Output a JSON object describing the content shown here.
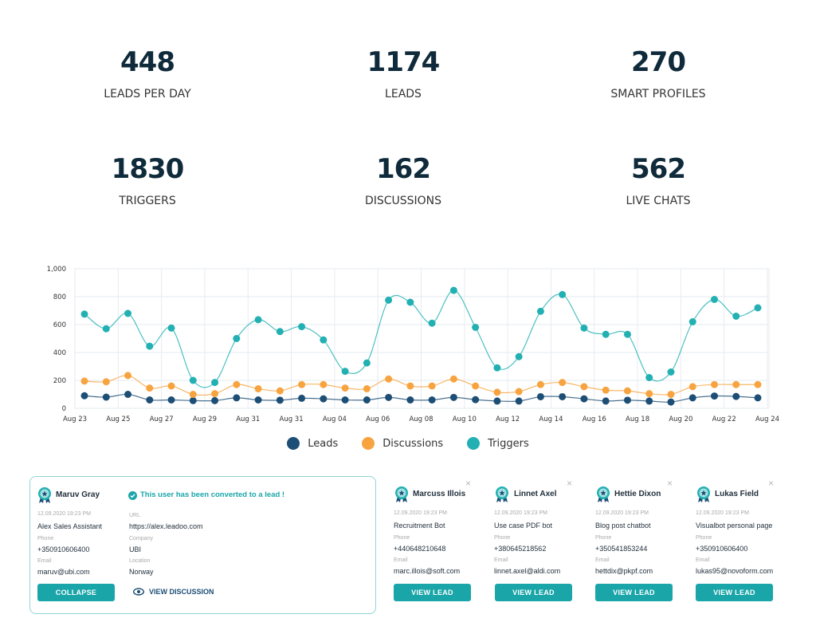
{
  "stats": [
    {
      "value": "448",
      "label": "LEADS PER DAY"
    },
    {
      "value": "1174",
      "label": "LEADS"
    },
    {
      "value": "270",
      "label": "SMART PROFILES"
    },
    {
      "value": "1830",
      "label": "TRIGGERS"
    },
    {
      "value": "162",
      "label": "DISCUSSIONS"
    },
    {
      "value": "562",
      "label": "LIVE CHATS"
    }
  ],
  "chart_data": {
    "type": "line",
    "title": "",
    "xlabel": "",
    "ylabel": "",
    "ylim": [
      0,
      1000
    ],
    "yticks": [
      "0",
      "200",
      "400",
      "600",
      "800",
      "1,000"
    ],
    "grid": true,
    "legend_position": "bottom",
    "x_tick_labels": [
      "Aug 23",
      "Aug 25",
      "Aug 27",
      "Aug 29",
      "Aug 31",
      "Aug 31",
      "Aug 04",
      "Aug 06",
      "Aug 08",
      "Aug 10",
      "Aug 12",
      "Aug 14",
      "Aug 16",
      "Aug 18",
      "Aug 20",
      "Aug 22",
      "Aug 24"
    ],
    "series": [
      {
        "name": "Leads",
        "color": "#1d4e75",
        "values": [
          90,
          80,
          100,
          60,
          60,
          55,
          55,
          75,
          60,
          58,
          72,
          68,
          60,
          60,
          78,
          60,
          60,
          78,
          62,
          52,
          52,
          83,
          83,
          68,
          52,
          58,
          52,
          45,
          75,
          88,
          85,
          75
        ]
      },
      {
        "name": "Discussions",
        "color": "#f7a440",
        "values": [
          195,
          190,
          235,
          145,
          160,
          100,
          105,
          170,
          140,
          125,
          170,
          170,
          145,
          140,
          210,
          160,
          160,
          210,
          160,
          115,
          120,
          170,
          185,
          155,
          130,
          125,
          105,
          100,
          155,
          170,
          170,
          170
        ]
      },
      {
        "name": "Triggers",
        "color": "#22b0b3",
        "values": [
          675,
          570,
          680,
          445,
          575,
          200,
          185,
          500,
          635,
          550,
          585,
          490,
          265,
          325,
          775,
          760,
          610,
          845,
          580,
          290,
          370,
          695,
          815,
          575,
          530,
          530,
          220,
          260,
          620,
          780,
          660,
          720
        ]
      }
    ]
  },
  "legend": [
    {
      "label": "Leads",
      "color": "#1d4e75"
    },
    {
      "label": "Discussions",
      "color": "#f7a440"
    },
    {
      "label": "Triggers",
      "color": "#22b0b3"
    }
  ],
  "expanded_card": {
    "name": "Maruv Gray",
    "converted_message": "This user has been converted to a lead !",
    "timestamp": "12.09.2020 19:23 PM",
    "bot": "Alex Sales Assistant",
    "phone_label": "Phone",
    "phone": "+350910606400",
    "email_label": "Email",
    "email": "maruv@ubi.com",
    "url_label": "URL",
    "url": "https://alex.leadoo.com",
    "company_label": "Company",
    "company": "UBI",
    "location_label": "Location",
    "location": "Norway",
    "collapse_label": "COLLAPSE",
    "view_discussion_label": "VIEW DISCUSSION"
  },
  "cards": [
    {
      "name": "Marcuss Illois",
      "timestamp": "12.09.2020 19:23 PM",
      "bot": "Recruitment Bot",
      "phone_label": "Phone",
      "phone": "+440648210648",
      "email_label": "Email",
      "email": "marc.illois@soft.com",
      "button": "VIEW LEAD"
    },
    {
      "name": "Linnet Axel",
      "timestamp": "12.09.2020 19:23 PM",
      "bot": "Use case PDF bot",
      "phone_label": "Phone",
      "phone": "+380645218562",
      "email_label": "Email",
      "email": "linnet.axel@aldi.com",
      "button": "VIEW LEAD"
    },
    {
      "name": "Hettie Dixon",
      "timestamp": "12.09.2020 19:23 PM",
      "bot": "Blog post chatbot",
      "phone_label": "Phone",
      "phone": "+350541853244",
      "email_label": "Email",
      "email": "hettdix@pkpf.com",
      "button": "VIEW LEAD"
    },
    {
      "name": "Lukas Field",
      "timestamp": "12.09.2020 19:23 PM",
      "bot": "Visualbot personal page",
      "phone_label": "Phone",
      "phone": "+350910606400",
      "email_label": "Email",
      "email": "lukas95@novoform.com",
      "button": "VIEW LEAD"
    }
  ],
  "close_glyph": "×",
  "accent_color": "#1aa5a9"
}
